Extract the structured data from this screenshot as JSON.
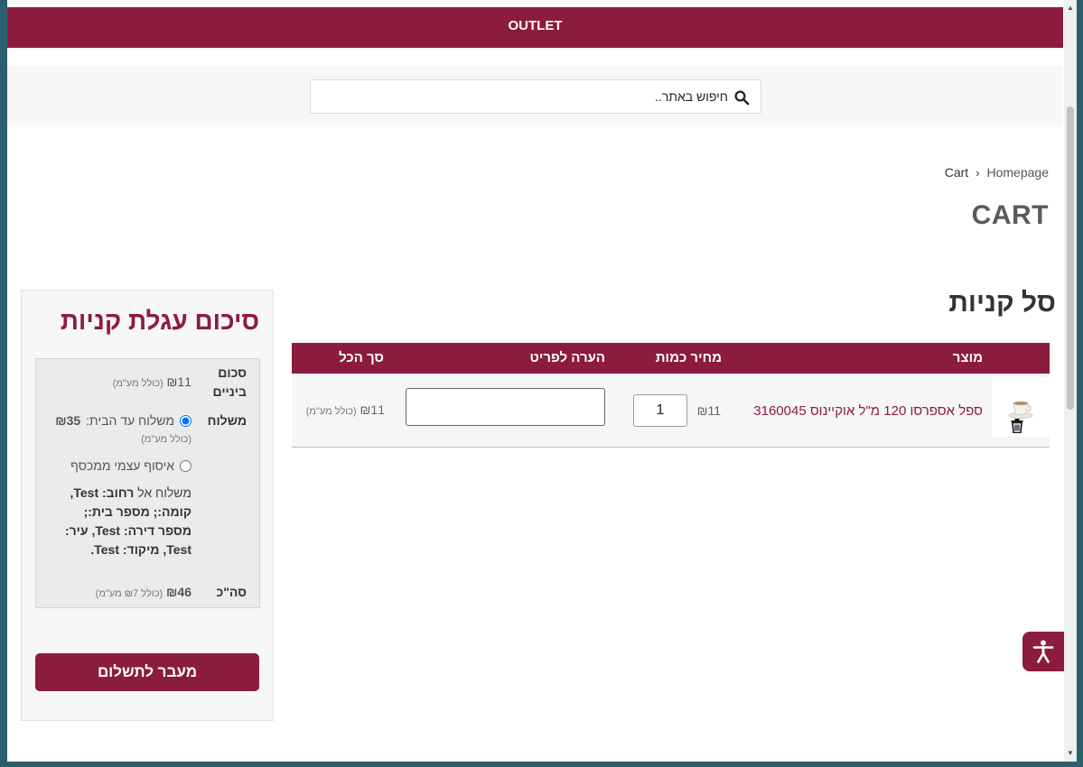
{
  "topbar": {
    "label": "OUTLET"
  },
  "search": {
    "placeholder": "חיפוש באתר.."
  },
  "breadcrumb": {
    "home": "Homepage",
    "current": "Cart"
  },
  "page": {
    "title": "CART"
  },
  "cart": {
    "heading": "סל קניות",
    "columns": {
      "product": "מוצר",
      "price": "מחיר כמות",
      "note": "הערה לפריט",
      "total": "סך הכל"
    },
    "items": [
      {
        "name": "ספל אספרסו 120 מ\"ל אוקיינוס 3160045",
        "unit_price": "₪11",
        "quantity": "1",
        "note": "",
        "total": "₪11",
        "total_vat": "(כולל מע\"מ)"
      }
    ]
  },
  "summary": {
    "title": "סיכום עגלת קניות",
    "subtotal_label": "סכום ביניים",
    "subtotal_value": "₪11",
    "subtotal_vat": "(כולל מע\"מ)",
    "shipping_label": "משלוח",
    "shipping_options": [
      {
        "label": "משלוח עד הבית:",
        "price": "₪35",
        "vat": "(כולל מע\"מ)",
        "selected": true
      },
      {
        "label": "איסוף עצמי ממכסף",
        "selected": false
      }
    ],
    "ship_to_prefix": "משלוח אל",
    "address": {
      "street_label": "רחוב:",
      "street": "Test,",
      "floor_label": "קומה:;",
      "house_label": "מספר בית:;",
      "apt_label": "מספר דירה:",
      "apt": "Test,",
      "city_label": "עיר:",
      "city": "Test,",
      "zip_label": "מיקוד:",
      "zip": "Test."
    },
    "total_label": "סה\"כ",
    "total_value": "₪46",
    "total_vat": "(כולל ₪7 מע\"מ)",
    "checkout_label": "מעבר לתשלום"
  },
  "colors": {
    "brand": "#8b1c3d",
    "panel": "#f7f7f7"
  },
  "icons": {
    "search": "search-icon",
    "trash": "trash-icon",
    "accessibility": "accessibility-icon"
  }
}
